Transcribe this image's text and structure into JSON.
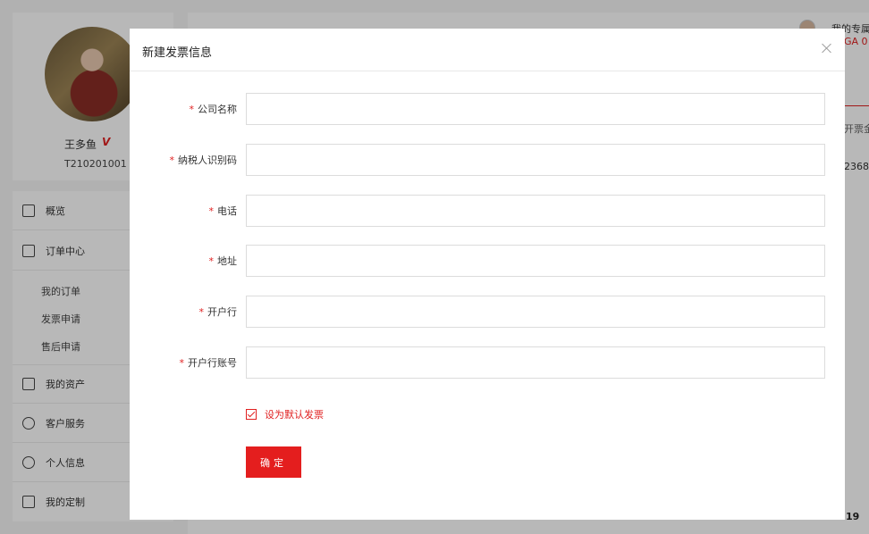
{
  "profile": {
    "name": "王多鱼",
    "vip": "V",
    "user_id": "T210201001"
  },
  "menu": {
    "items": [
      {
        "label": "概览",
        "icon": "chart-icon"
      },
      {
        "label": "订单中心",
        "icon": "order-icon"
      },
      {
        "label": "我的资产",
        "icon": "wallet-icon"
      },
      {
        "label": "客户服务",
        "icon": "heart-icon"
      },
      {
        "label": "个人信息",
        "icon": "user-icon"
      },
      {
        "label": "我的定制",
        "icon": "custom-icon"
      }
    ],
    "sub_items": [
      "我的订单",
      "发票申请",
      "售后申请"
    ]
  },
  "background": {
    "user_label": "我的专属",
    "badge": "GA 0",
    "col_header": "开票金",
    "col_value": "2368.",
    "bottom_amount": "19"
  },
  "modal": {
    "title": "新建发票信息",
    "fields": [
      {
        "label": "公司名称",
        "value": "",
        "placeholder": ""
      },
      {
        "label": "纳税人识别码",
        "value": "",
        "placeholder": ""
      },
      {
        "label": "电话",
        "value": "",
        "placeholder": ""
      },
      {
        "label": "地址",
        "value": "",
        "placeholder": ""
      },
      {
        "label": "开户行",
        "value": "",
        "placeholder": ""
      },
      {
        "label": "开户行账号",
        "value": "",
        "placeholder": ""
      }
    ],
    "required_mark": "*",
    "default_checkbox_label": "设为默认发票",
    "default_checked": true,
    "confirm_label": "确定"
  },
  "colors": {
    "accent": "#e41e1e",
    "overlay": "rgba(0,0,0,0.28)"
  }
}
